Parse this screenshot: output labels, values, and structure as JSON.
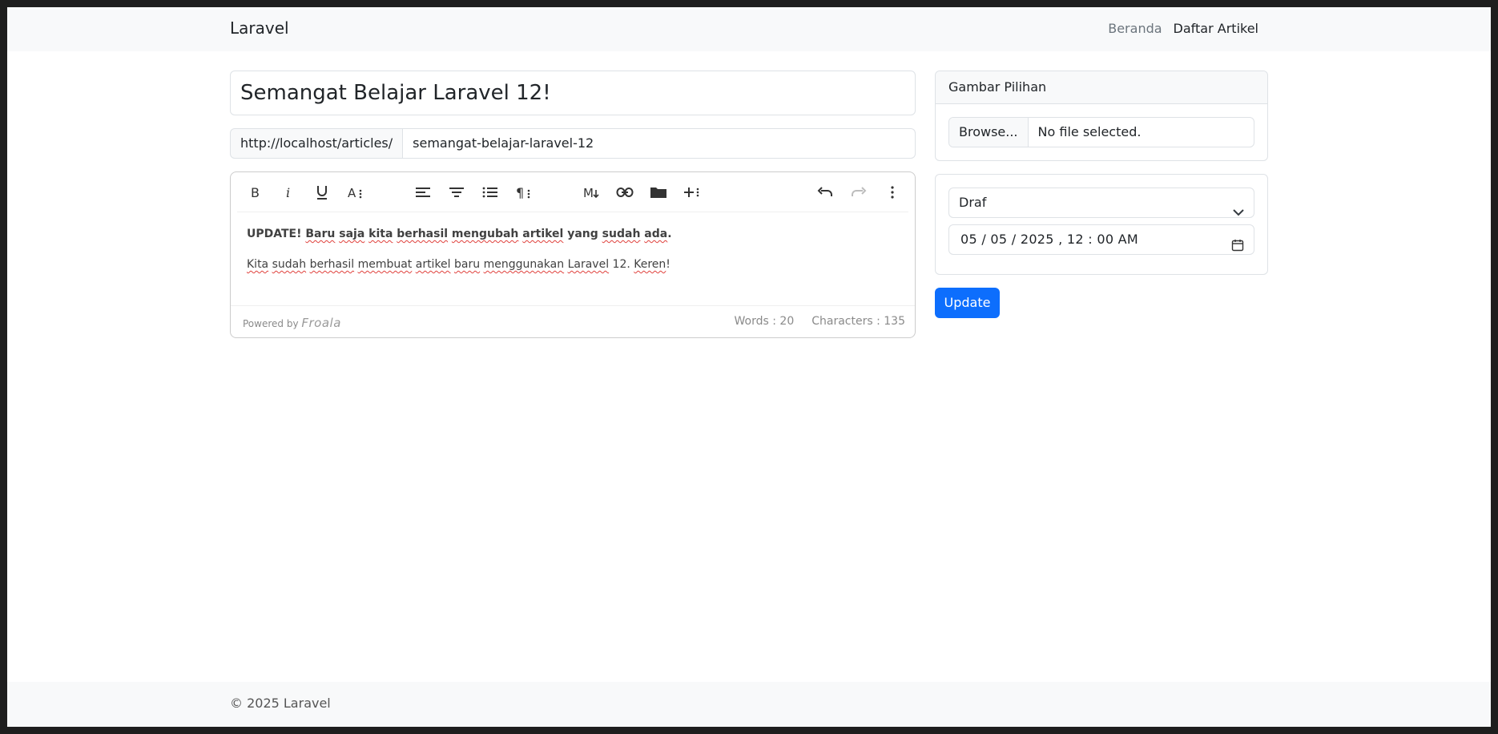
{
  "navbar": {
    "brand": "Laravel",
    "links": [
      {
        "label": "Beranda"
      },
      {
        "label": "Daftar Artikel"
      }
    ]
  },
  "article": {
    "title": "Semangat Belajar Laravel 12!",
    "slug_prefix": "http://localhost/articles/",
    "slug": "semangat-belajar-laravel-12"
  },
  "editor": {
    "toolbar_icons": [
      "bold-icon",
      "italic-icon",
      "underline-icon",
      "font-size-icon",
      "align-left-icon",
      "align-center-icon",
      "ordered-list-icon",
      "paragraph-format-icon",
      "markdown-icon",
      "link-icon",
      "folder-icon",
      "insert-more-icon",
      "undo-icon",
      "redo-icon",
      "more-options-icon"
    ],
    "paragraph1": {
      "w1": "UPDATE!",
      "w2": "Baru",
      "w3": "saja",
      "w4": "kita",
      "w5": "berhasil",
      "w6": "mengubah",
      "w7": "artikel",
      "w8": "yang",
      "w9": "sudah",
      "w10": "ada",
      "end": "."
    },
    "paragraph2": {
      "w1": "Kita",
      "w2": "sudah",
      "w3": "berhasil",
      "w4": "membuat",
      "w5": "artikel",
      "w6": "baru",
      "w7": "menggunakan",
      "w8": "Laravel",
      "w9": "12.",
      "w10": "Keren",
      "end": "!"
    },
    "powered_by": "Powered by",
    "powered_brand": "Froala",
    "words": "Words : 20",
    "characters": "Characters : 135"
  },
  "sidebar": {
    "image_card_title": "Gambar Pilihan",
    "browse_label": "Browse...",
    "file_status": "No file selected.",
    "status_value": "Draf",
    "datetime_value": "05 / 05 / 2025 ,  12 : 00   AM",
    "update_label": "Update"
  },
  "footer": {
    "text": "© 2025 Laravel"
  }
}
